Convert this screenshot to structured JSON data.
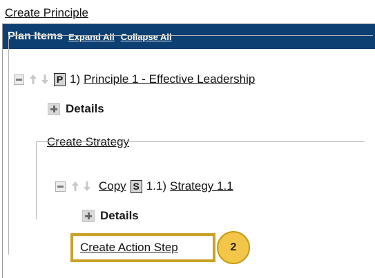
{
  "create_principle": "Create Principle",
  "panel": {
    "title": "Plan Items",
    "expand_all": "Expand All",
    "collapse_all": "Collapse All"
  },
  "principle": {
    "badge": "P",
    "number": "1)",
    "title": "Principle 1 - Effective Leadership",
    "details_label": "Details",
    "create_strategy": "Create Strategy"
  },
  "strategy": {
    "copy": "Copy",
    "badge": "S",
    "number": "1.1)",
    "title": "Strategy 1.1",
    "details_label": "Details",
    "create_action_step": "Create Action Step"
  },
  "callout": {
    "number": "2",
    "color": "#f3c64a",
    "border_color": "#c9a227"
  },
  "colors": {
    "header_bg": "#0d3f72"
  }
}
